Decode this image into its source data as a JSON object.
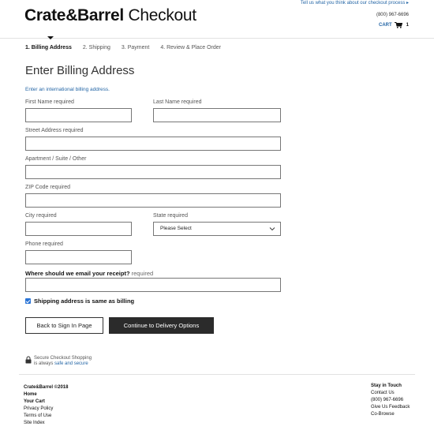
{
  "header": {
    "logo_bold": "Crate&Barrel",
    "logo_light": " Checkout",
    "feedback_link": "Tell us what you think about our checkout process ▸",
    "phone": "(800) 967-6696",
    "cart_label": "CART",
    "cart_count": "1"
  },
  "steps": [
    {
      "label": "1. Billing Address"
    },
    {
      "label": "2. Shipping"
    },
    {
      "label": "3. Payment"
    },
    {
      "label": "4. Review & Place Order"
    }
  ],
  "form": {
    "title": "Enter Billing Address",
    "intl_link": "Enter an international billing address.",
    "first_name_label": "First Name required",
    "last_name_label": "Last Name required",
    "street_label": "Street Address required",
    "apartment_label": "Apartment / Suite / Other",
    "zip_label": "ZIP Code required",
    "city_label": "City required",
    "state_label": "State required",
    "state_value": "Please Select",
    "phone_label": "Phone required",
    "receipt_question": "Where should we email your receipt?",
    "receipt_required": "required",
    "shipping_same_label": "Shipping address is same as billing"
  },
  "buttons": {
    "back": "Back to Sign In Page",
    "continue": "Continue to Delivery Options"
  },
  "secure": {
    "line1": "Secure Checkout Shopping",
    "line2_prefix": "is always ",
    "line2_link": "safe and secure"
  },
  "footer": {
    "copyright": "Crate&Barrel ©2018",
    "home": "Home",
    "your_cart": "Your Cart",
    "privacy": "Privacy Policy",
    "terms": "Terms of Use",
    "site_index": "Site Index",
    "stay_in_touch": "Stay in Touch",
    "contact_us": "Contact Us",
    "phone": "(800) 967-6696",
    "give_feedback": "Give Us Feedback",
    "co_browse": "Co-Browse"
  },
  "colors": {
    "link": "#2466a6",
    "primary_button": "#2b2b2b",
    "checkbox": "#2a74d6"
  }
}
